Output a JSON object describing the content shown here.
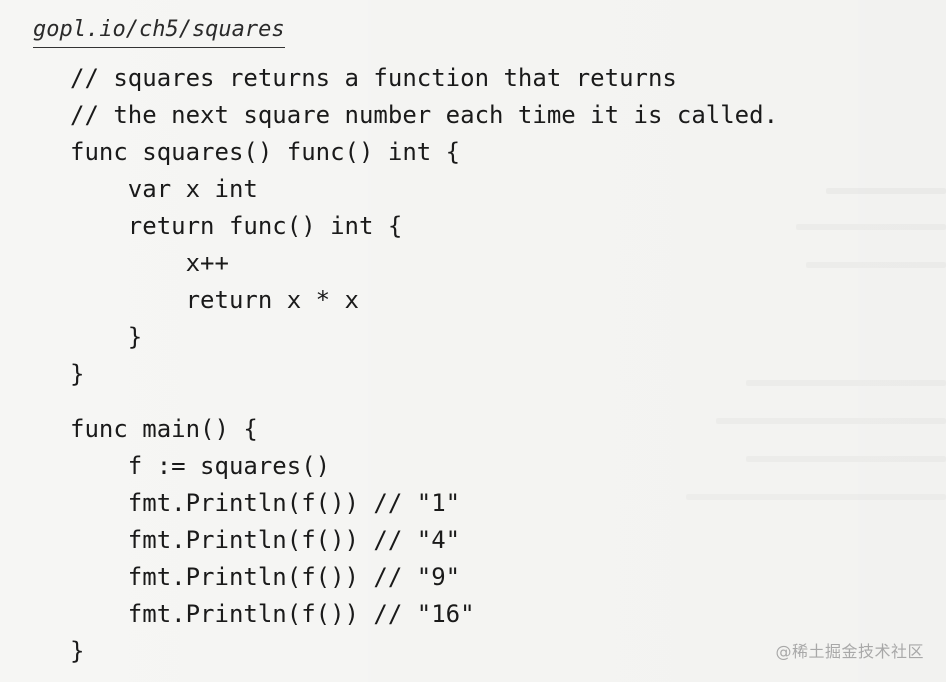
{
  "document": {
    "source_path": "gopl.io/ch5/squares",
    "code_lines_part1": [
      "// squares returns a function that returns",
      "// the next square number each time it is called.",
      "func squares() func() int {",
      "    var x int",
      "    return func() int {",
      "        x++",
      "        return x * x",
      "    }",
      "}"
    ],
    "code_lines_part2": [
      "func main() {",
      "    f := squares()",
      "    fmt.Println(f()) // \"1\"",
      "    fmt.Println(f()) // \"4\"",
      "    fmt.Println(f()) // \"9\"",
      "    fmt.Println(f()) // \"16\"",
      "}"
    ],
    "watermark": "@稀土掘金技术社区"
  }
}
